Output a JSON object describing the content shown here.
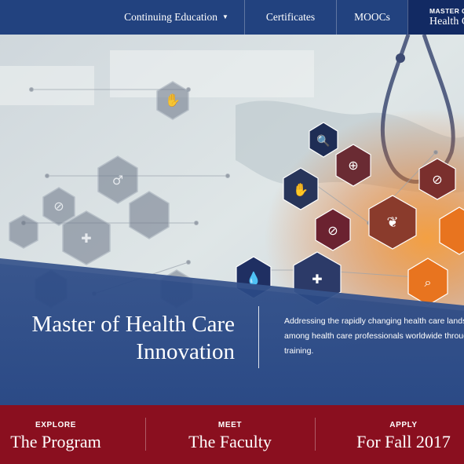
{
  "nav": {
    "continuing_education": "Continuing Education",
    "certificates": "Certificates",
    "moocs": "MOOCs",
    "active_small": "MASTER OF",
    "active_big": "Health Care"
  },
  "hero": {
    "title_line1": "Master of Health Care",
    "title_line2": "Innovation",
    "desc_line1": "Addressing the rapidly changing health care landscape by a",
    "desc_line2": "among health care professionals worldwide through online",
    "desc_line3": "training."
  },
  "cta": [
    {
      "kicker": "EXPLORE",
      "label": "The Program"
    },
    {
      "kicker": "MEET",
      "label": "The Faculty"
    },
    {
      "kicker": "APPLY",
      "label": "For Fall 2017"
    }
  ],
  "icons": [
    "ban-icon",
    "hand-stop-icon",
    "clipboard-icon",
    "male-symbol-icon",
    "pill-icon",
    "search-icon",
    "plant-icon",
    "first-aid-icon",
    "drop-icon",
    "first-aid-kit-icon",
    "chart-icon"
  ],
  "colors": {
    "nav_bg": "#22427f",
    "nav_active": "#122a63",
    "hero_band": "#2b4a86",
    "cta_bg": "#8a0f1f",
    "accent_orange": "#e8741f"
  }
}
